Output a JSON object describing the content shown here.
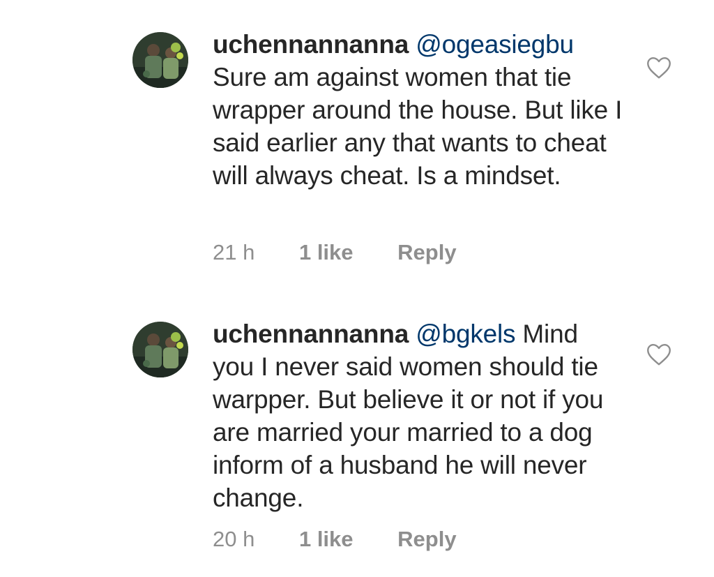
{
  "comments": [
    {
      "username": "uchennannanna",
      "mention": "@ogeasiegbu",
      "text": "Sure am against women that tie wrapper around the house. But like I said earlier any that wants to cheat will always cheat. Is a mindset.",
      "time": "21 h",
      "likes": "1 like",
      "reply": "Reply",
      "avatar_icon": "user-avatar-photo",
      "like_icon": "heart-outline-icon"
    },
    {
      "username": "uchennannanna",
      "mention": "@bgkels",
      "text": "Mind you I never said women should tie warpper. But believe it or not if you are married your married to a dog inform of a husband he will never change.",
      "time": "20 h",
      "likes": "1 like",
      "reply": "Reply",
      "avatar_icon": "user-avatar-photo",
      "like_icon": "heart-outline-icon"
    }
  ],
  "colors": {
    "text": "#262626",
    "mention": "#00376b",
    "meta": "#8e8e8e",
    "heart_stroke": "#8e8e8e"
  }
}
